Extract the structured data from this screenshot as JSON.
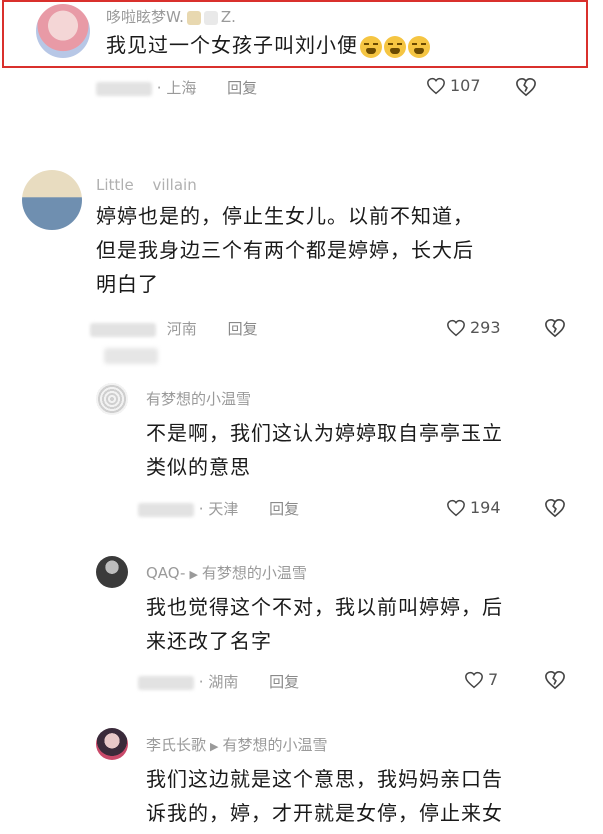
{
  "comments": [
    {
      "username": "哆啦眩梦W.",
      "username_suffix": "Z.",
      "text": "我见过一个女孩子叫刘小便",
      "location": "上海",
      "reply_label": "回复",
      "likes": "107"
    },
    {
      "username": "Little villain",
      "text_lines": [
        "婷婷也是的，停止生女儿。以前不知道，",
        "但是我身边三个有两个都是婷婷，长大后",
        "明白了"
      ],
      "location": "河南",
      "reply_label": "回复",
      "likes": "293"
    },
    {
      "username": "有梦想的小温雪",
      "text_lines": [
        "不是啊，我们这认为婷婷取自亭亭玉立",
        "类似的意思"
      ],
      "location": "天津",
      "reply_label": "回复",
      "likes": "194"
    },
    {
      "username": "QAQ-",
      "reply_to": "有梦想的小温雪",
      "text_lines": [
        "我也觉得这个不对，我以前叫婷婷，后",
        "来还改了名字"
      ],
      "location": "湖南",
      "reply_label": "回复",
      "likes": "7"
    },
    {
      "username": "李氏长歌",
      "reply_to": "有梦想的小温雪",
      "text_lines": [
        "我们这边就是这个意思，我妈妈亲口告",
        "诉我的，婷，才开就是女停，停止来女"
      ]
    }
  ],
  "colors": {
    "highlight_border": "#d9302c",
    "secondary_text": "#9a9a9a"
  }
}
